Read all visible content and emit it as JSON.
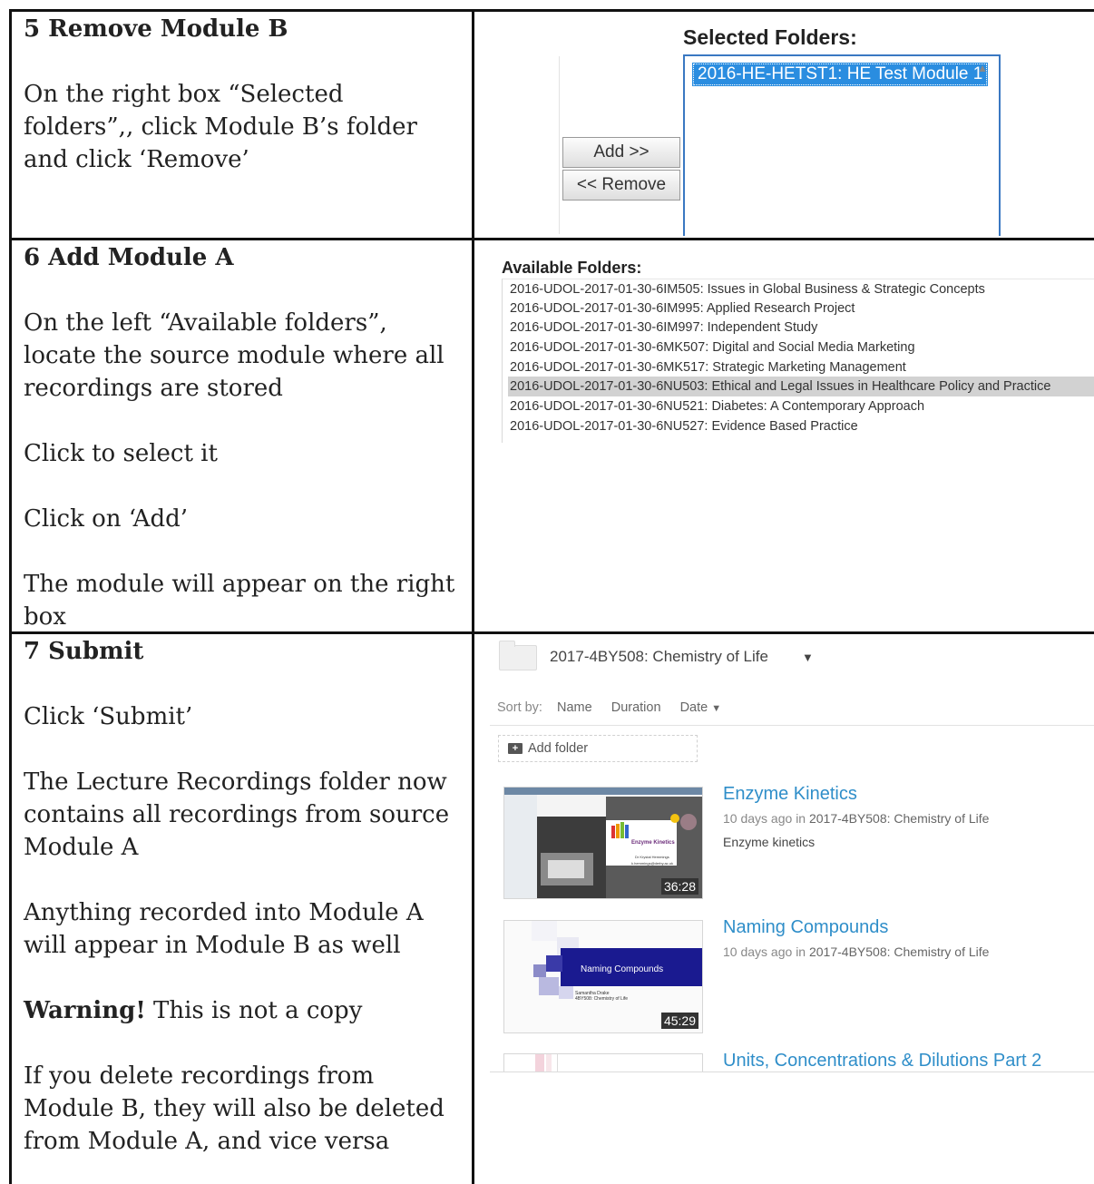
{
  "steps": [
    {
      "heading": "5 Remove Module B",
      "paragraphs": [
        "On the right box “Selected folders”,, click Module B’s folder and click ‘Remove’"
      ]
    },
    {
      "heading": "6 Add Module A",
      "paragraphs": [
        "On the left “Available folders”, locate the source module where all recordings are stored",
        "Click to select it",
        "Click on ‘Add’",
        "The module will appear on the right box"
      ]
    },
    {
      "heading": "7 Submit",
      "paragraphs": [
        "Click ‘Submit’",
        "The Lecture Recordings folder now contains all recordings from source Module A",
        "Anything recorded into Module A will appear in Module B as well",
        "This is not a copy",
        "If you delete recordings from Module B, they will also be deleted from Module A, and vice versa"
      ],
      "warning_label": "Warning!"
    }
  ],
  "selected_panel": {
    "title": "Selected Folders:",
    "items": [
      "2016-HE-HETST1: HE Test Module 1"
    ],
    "add_button": "Add  >>",
    "remove_button": "<<  Remove"
  },
  "available_panel": {
    "title": "Available Folders:",
    "items": [
      "2016-UDOL-2017-01-30-6IM505: Issues in Global Business & Strategic Concepts",
      "2016-UDOL-2017-01-30-6IM995: Applied Research Project",
      "2016-UDOL-2017-01-30-6IM997: Independent Study",
      "2016-UDOL-2017-01-30-6MK507: Digital and Social Media Marketing",
      "2016-UDOL-2017-01-30-6MK517: Strategic Marketing Management",
      "2016-UDOL-2017-01-30-6NU503: Ethical and Legal Issues in Healthcare Policy and Practice",
      "2016-UDOL-2017-01-30-6NU521: Diabetes: A Contemporary Approach",
      "2016-UDOL-2017-01-30-6NU527: Evidence Based Practice"
    ],
    "selected_index": 5
  },
  "folder_view": {
    "folder_name": "2017-4BY508: Chemistry of Life",
    "sort_label": "Sort by:",
    "sort_options": [
      "Name",
      "Duration",
      "Date"
    ],
    "add_folder": "Add folder",
    "recordings": [
      {
        "title": "Enzyme Kinetics",
        "age": "10 days ago",
        "in_word": "in",
        "folder": "2017-4BY508: Chemistry of Life",
        "description": "Enzyme kinetics",
        "duration": "36:28",
        "slide_title": "Enzyme Kinetics",
        "slide_author": "Dr Krystal Hemmings",
        "slide_email": "k.hemmings@derby.ac.uk"
      },
      {
        "title": "Naming Compounds",
        "age": "10 days ago",
        "in_word": "in",
        "folder": "2017-4BY508: Chemistry of Life",
        "description": "",
        "duration": "45:29",
        "slide_title": "Naming Compounds",
        "slide_author": "Samantha Drake",
        "slide_course": "4BY508: Chemistry of Life"
      },
      {
        "title": "Units, Concentrations & Dilutions Part 2"
      }
    ]
  }
}
